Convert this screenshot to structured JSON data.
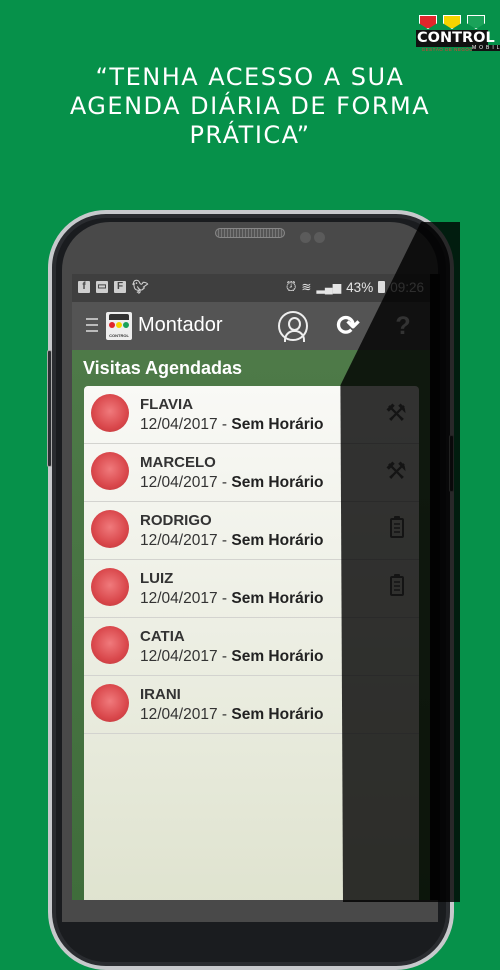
{
  "brand": {
    "name": "CONTROL",
    "sub": "MOBILE",
    "tagline": "GESTÃO DE NEGÓCIOS",
    "flag_colors": [
      "#e0262b",
      "#f6d400",
      "#1aa259"
    ]
  },
  "headline": {
    "lines": [
      "“TENHA ACESSO A SUA",
      "AGENDA DIÁRIA DE FORMA",
      "PRÁTICA”"
    ]
  },
  "statusbar": {
    "left_icons": [
      "facebook-icon",
      "gallery-icon",
      "flipboard-icon",
      "twitter-icon"
    ],
    "right_icons": [
      "alarm-icon",
      "wifi-icon",
      "signal-icon"
    ],
    "battery": "43%",
    "time": "09:26"
  },
  "toolbar": {
    "title": "Montador",
    "menu_icon": "hamburger-icon",
    "actions": [
      "user-icon",
      "refresh-icon",
      "help-icon"
    ],
    "help_label": "?",
    "refresh_label": "⟳"
  },
  "main": {
    "section_title": "Visitas Agendadas",
    "visits": [
      {
        "name": "FLAVIA",
        "date": "12/04/2017",
        "separator": " - ",
        "time": "Sem Horário",
        "icon": "tools-icon"
      },
      {
        "name": "MARCELO",
        "date": "12/04/2017",
        "separator": " - ",
        "time": "Sem Horário",
        "icon": "tools-icon"
      },
      {
        "name": "RODRIGO",
        "date": "12/04/2017",
        "separator": " - ",
        "time": "Sem Horário",
        "icon": "clipboard-icon"
      },
      {
        "name": "LUIZ",
        "date": "12/04/2017",
        "separator": " - ",
        "time": "Sem Horário",
        "icon": "clipboard-icon"
      },
      {
        "name": "CATIA",
        "date": "12/04/2017",
        "separator": " - ",
        "time": "Sem Horário",
        "icon": ""
      },
      {
        "name": "IRANI",
        "date": "12/04/2017",
        "separator": " - ",
        "time": "Sem Horário",
        "icon": ""
      }
    ],
    "status_color": "#d9474b"
  },
  "colors": {
    "background": "#06914a",
    "toolbar": "#545454",
    "content_green": "#4e7a48"
  }
}
